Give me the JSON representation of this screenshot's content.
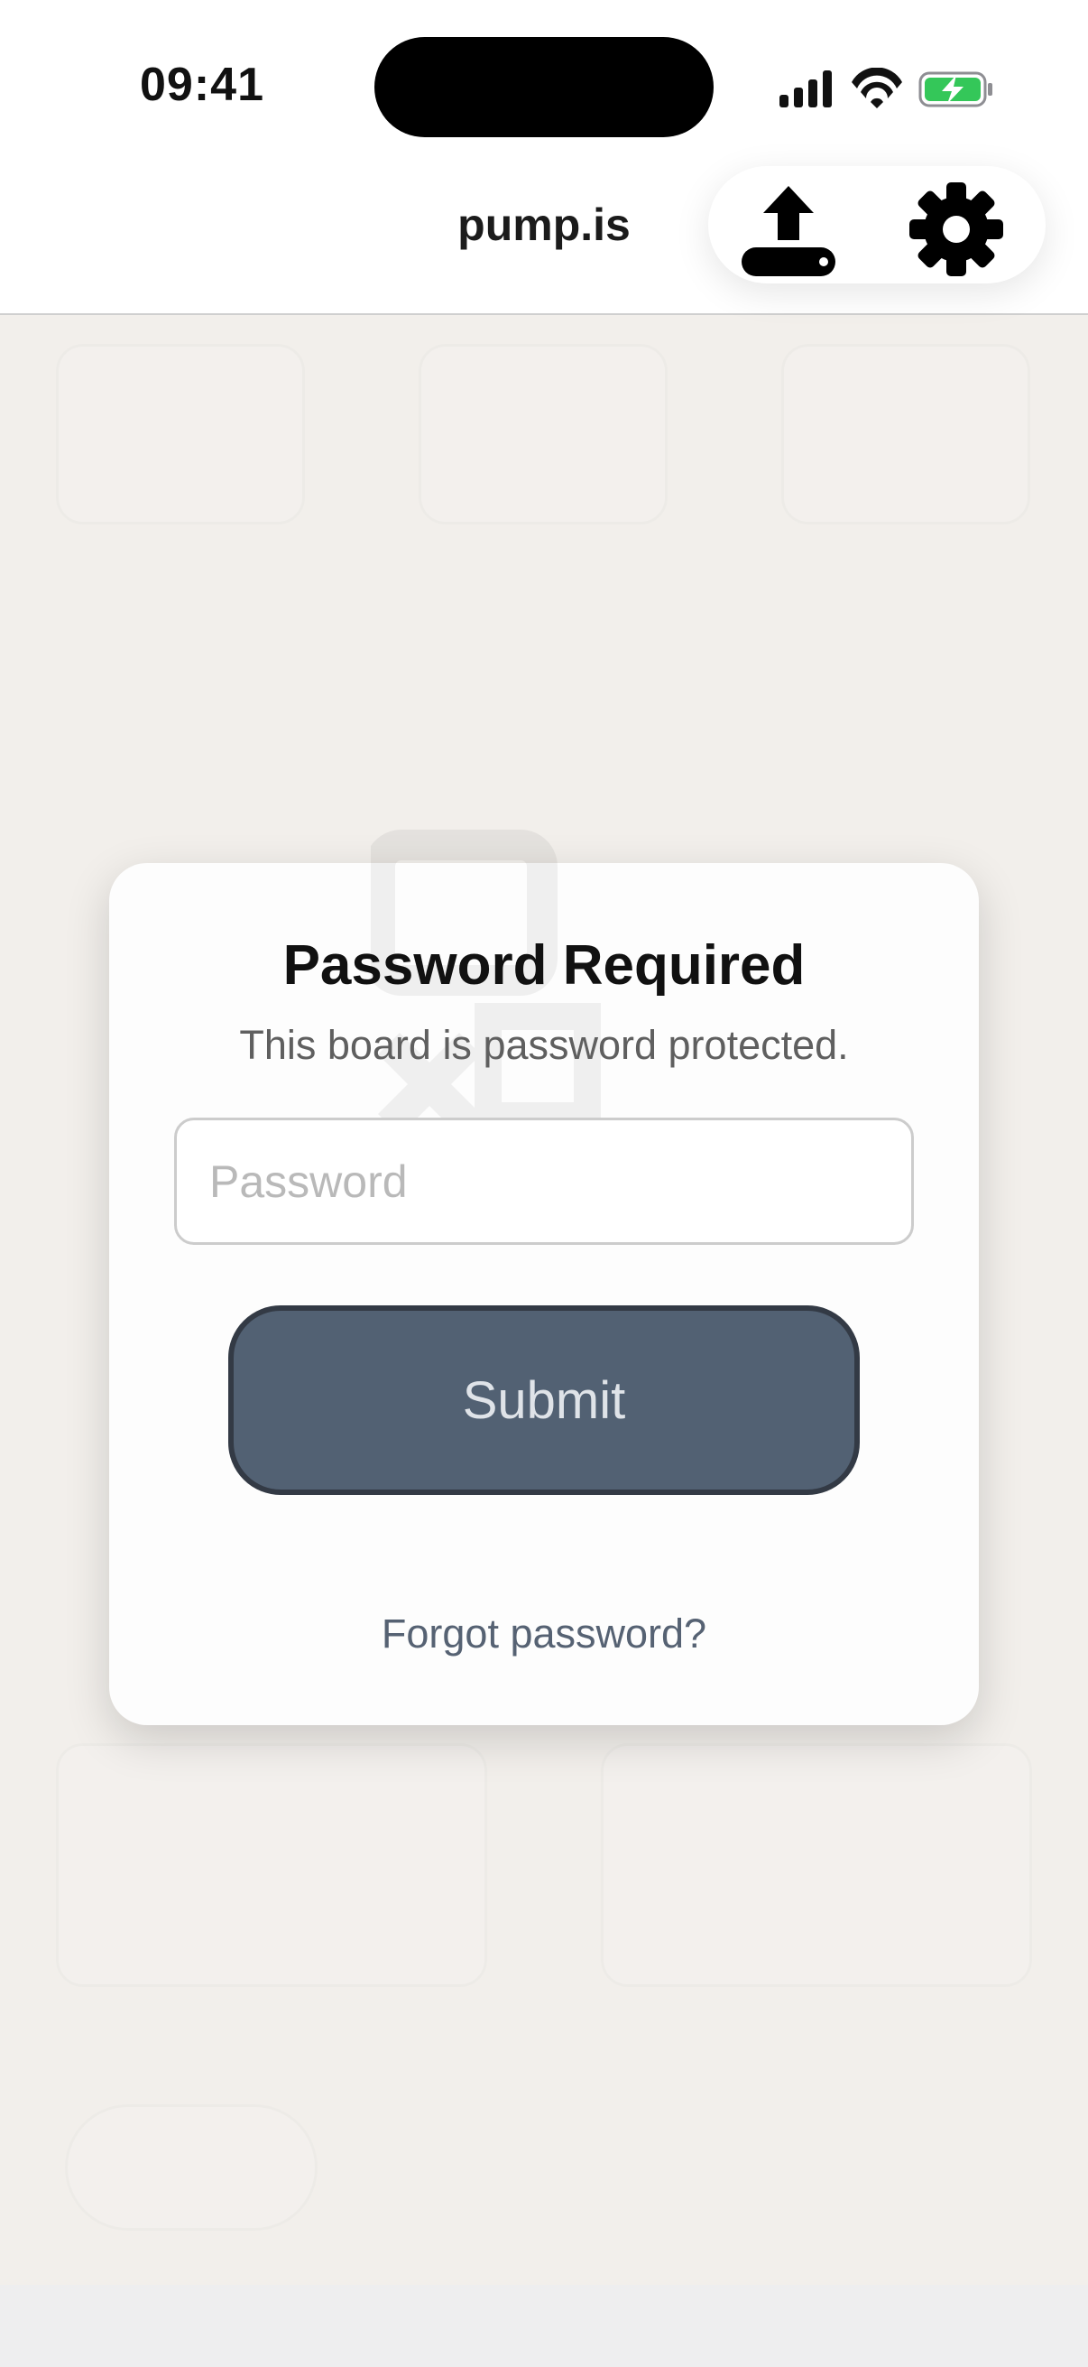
{
  "status_bar": {
    "time": "09:41",
    "icons": [
      "signal-icon",
      "wifi-icon",
      "battery-charging-icon"
    ]
  },
  "header": {
    "title": "pump.is",
    "actions": [
      {
        "icon": "upload-icon"
      },
      {
        "icon": "gear-icon"
      }
    ]
  },
  "modal": {
    "title": "Password Required",
    "subtitle": "This board is password protected.",
    "password_placeholder": "Password",
    "password_value": "",
    "submit_label": "Submit",
    "forgot_link": "Forgot password?"
  },
  "colors": {
    "background": "#f2efeb",
    "submit_fill": "#526173",
    "submit_border": "#333a45",
    "link": "#566273",
    "battery": "#34c759"
  }
}
